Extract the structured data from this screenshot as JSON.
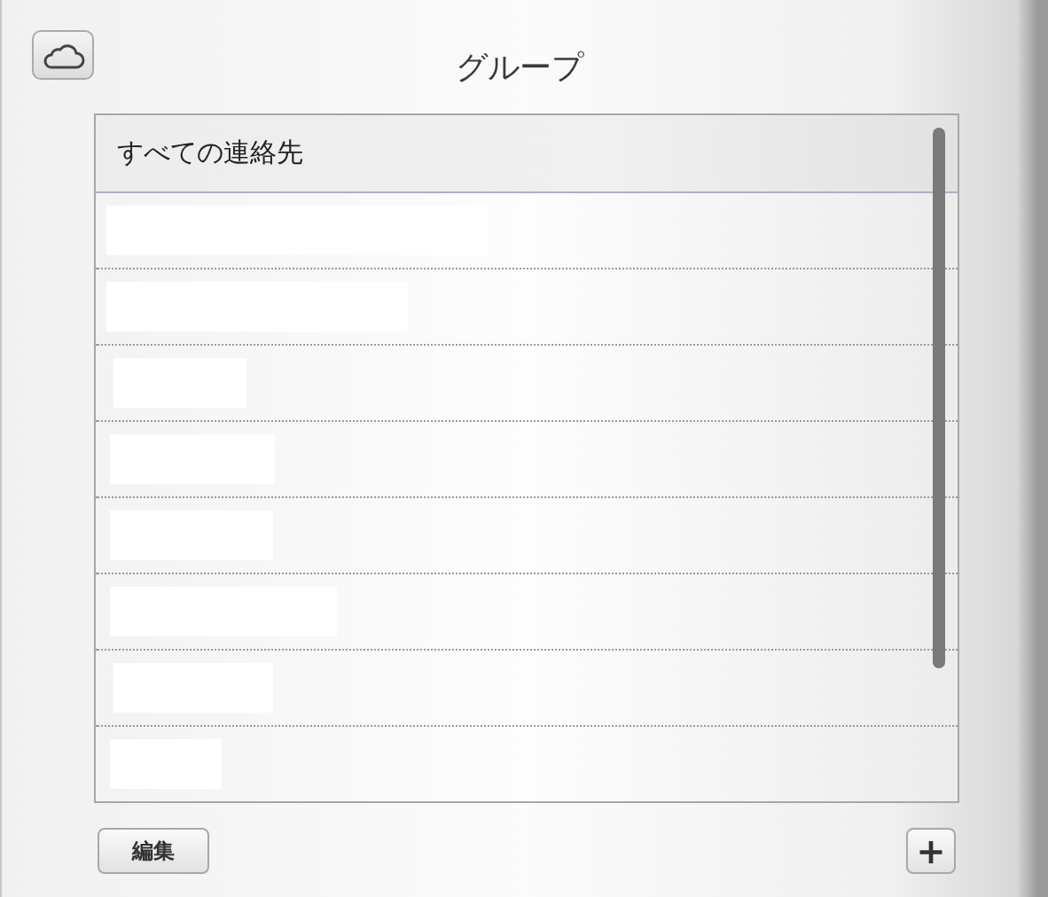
{
  "title": "グループ",
  "groups": [
    {
      "kind": "group",
      "label": "すべての連絡先",
      "selected": true
    },
    {
      "kind": "redacted",
      "selected": false
    },
    {
      "kind": "redacted",
      "selected": false
    },
    {
      "kind": "redacted",
      "selected": false
    },
    {
      "kind": "redacted",
      "selected": false
    },
    {
      "kind": "redacted",
      "selected": false
    },
    {
      "kind": "redacted",
      "selected": false
    },
    {
      "kind": "redacted",
      "selected": false
    },
    {
      "kind": "redacted",
      "selected": false
    }
  ],
  "buttons": {
    "edit": "編集",
    "add": "+"
  }
}
